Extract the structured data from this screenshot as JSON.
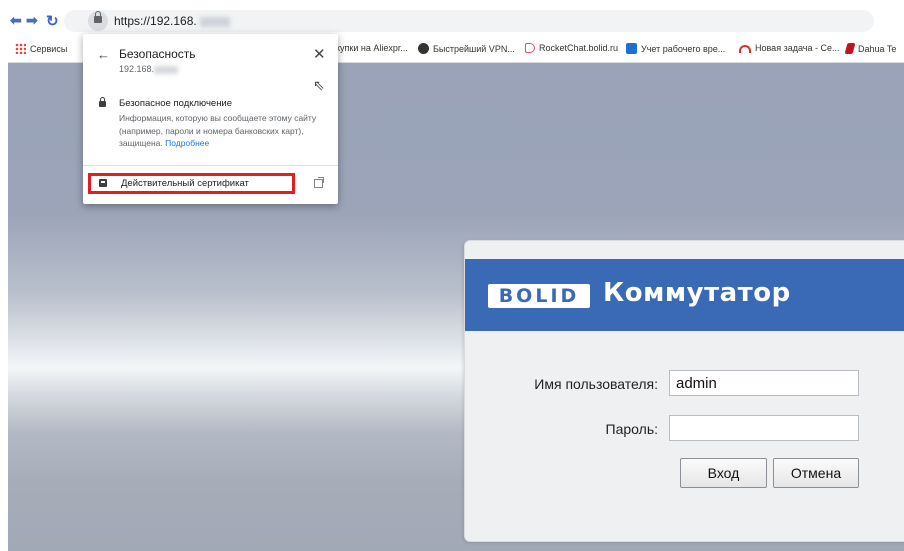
{
  "browser": {
    "url_text": "https://192.168.",
    "back_icon": "back-arrow",
    "forward_icon": "forward-arrow",
    "reload_icon": "reload"
  },
  "bookmarks": [
    {
      "label": "Сервисы",
      "icon": "apps-grid-icon",
      "color": "#e8453c"
    },
    {
      "label": "купки на Aliexpr...",
      "icon": "",
      "color": ""
    },
    {
      "label": "Быстрейший VPN...",
      "icon": "vpn-icon",
      "color": "#333333"
    },
    {
      "label": "RocketChat.bolid.ru",
      "icon": "rocketchat-icon",
      "color": "#e44c62"
    },
    {
      "label": "Учет рабочего вре...",
      "icon": "tracker-icon",
      "color": "#1f6fd0"
    },
    {
      "label": "Новая задача - Се...",
      "icon": "task-icon",
      "color": "#d1302f"
    },
    {
      "label": "Dahua Te",
      "icon": "dahua-icon",
      "color": "#c0151f"
    }
  ],
  "security_popup": {
    "title": "Безопасность",
    "host": "192.168.",
    "connection_title": "Безопасное подключение",
    "connection_text": "Информация, которую вы сообщаете этому сайту (например, пароли и номера банковских карт), защищена.",
    "more_link": "Подробнее",
    "certificate_label": "Действительный сертификат",
    "highlight_color": "#e31e1e"
  },
  "login": {
    "logo_text": "BOLID",
    "title": "Коммутатор",
    "username_label": "Имя пользователя:",
    "username_value": "admin",
    "password_label": "Пароль:",
    "password_value": "",
    "login_button": "Вход",
    "cancel_button": "Отмена",
    "brand_color": "#3a69b5"
  }
}
